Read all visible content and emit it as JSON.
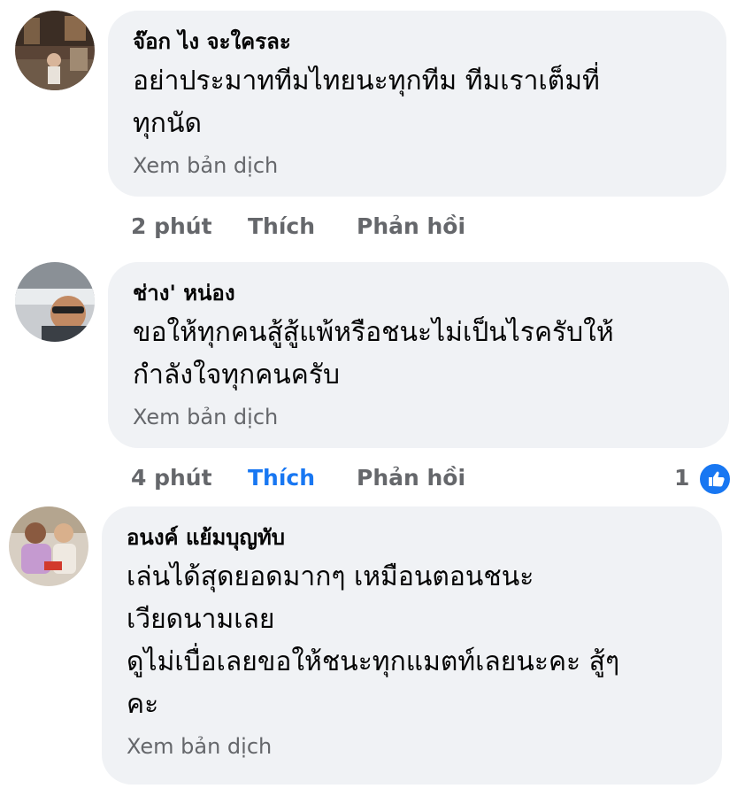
{
  "comments": [
    {
      "author": "จ๊อก ไง จะใครละ",
      "text_lines": [
        "อย่าประมาททีมไทยนะทุกทีม ทีมเราเต็มที่",
        "ทุกนัด"
      ],
      "translate_label": "Xem bản dịch",
      "time": "2 phút",
      "like_label": "Thích",
      "reply_label": "Phản hồi",
      "liked": false
    },
    {
      "author": "ช่าง' หน่อง",
      "text_lines": [
        "ขอให้ทุกคนสู้สู้แพ้หรือชนะไม่เป็นไรครับให้",
        "กำลังใจทุกคนครับ"
      ],
      "translate_label": "Xem bản dịch",
      "time": "4 phút",
      "like_label": "Thích",
      "reply_label": "Phản hồi",
      "liked": true,
      "reaction_count": "1",
      "reaction_icon": "thumbs-up-icon"
    },
    {
      "author": "อนงค์ แย้มบุญทับ",
      "text_lines": [
        "เล่นได้สุดยอดมากๆ เหมือนตอนชนะ",
        "เวียดนามเลย",
        "ดูไม่เบื่อเลยขอให้ชนะทุกแมตท์เลยนะคะ สู้ๆ",
        "คะ"
      ],
      "translate_label": "Xem bản dịch"
    }
  ],
  "colors": {
    "bubble": "#f0f2f5",
    "meta": "#65676b",
    "accent": "#1877f2"
  }
}
